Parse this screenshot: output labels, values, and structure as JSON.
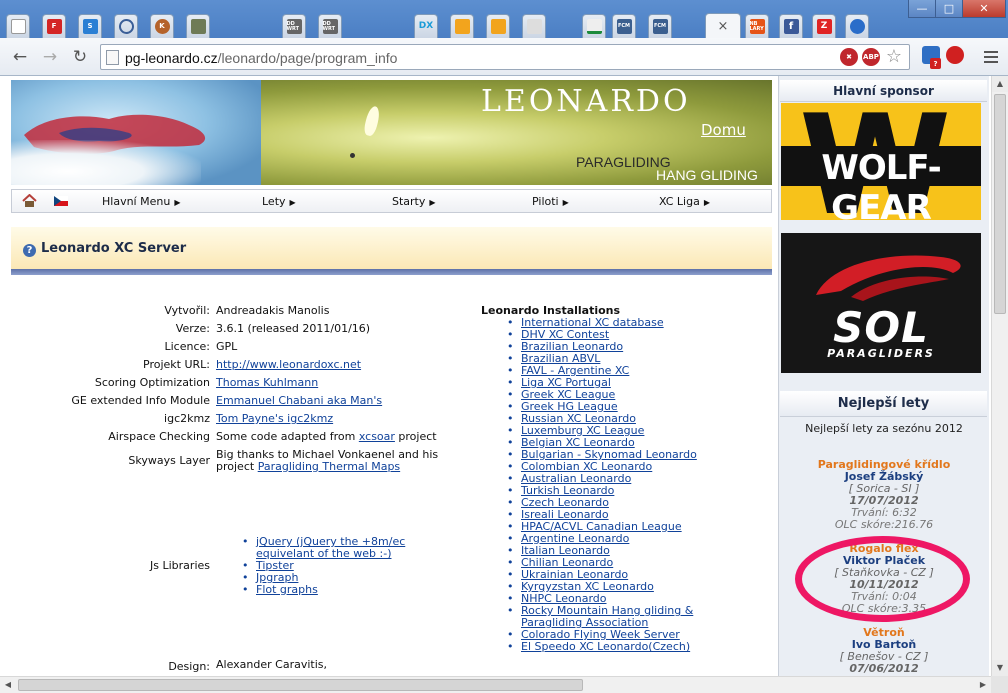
{
  "browser": {
    "tabs": [
      "",
      "F",
      "S",
      "",
      "K",
      "",
      "DD WRT",
      "DD WRT",
      "DX",
      "",
      "",
      "",
      "",
      "FCM",
      "FCM",
      "",
      "NB LARY",
      "f",
      "Z",
      ""
    ],
    "window_minimize": "—",
    "window_maximize": "□",
    "window_close": "✕",
    "tab_close": "×",
    "url_host": "pg-leonardo.cz",
    "url_path": "/leonardo/page/program_info",
    "ext_abp": "ABP",
    "ext_alert": "?"
  },
  "colors": {
    "accent": "#10429a",
    "orange": "#e2771c",
    "highlight_ring": "#ee1764",
    "wolf_yellow": "#f7c21a"
  },
  "banner": {
    "title": "LEONARDO",
    "home_link": "Domu",
    "subtitle_1": "PARAGLIDING",
    "subtitle_2": "HANG GLIDING"
  },
  "nav": {
    "home_icon": "house-icon",
    "flag_icon": "czech-flag-icon",
    "items": [
      {
        "label": "Hlavní Menu",
        "arrow": "▶"
      },
      {
        "label": "Lety",
        "arrow": "▶"
      },
      {
        "label": "Starty",
        "arrow": "▶"
      },
      {
        "label": "Piloti",
        "arrow": "▶"
      },
      {
        "label": "XC Liga",
        "arrow": "▶"
      }
    ]
  },
  "section": {
    "icon": "?",
    "title": "Leonardo XC Server"
  },
  "info": {
    "rows": [
      {
        "label": "Vytvořil:",
        "value": "Andreadakis Manolis"
      },
      {
        "label": "Verze:",
        "value": "3.6.1 (released 2011/01/16)"
      },
      {
        "label": "Licence:",
        "value": "GPL"
      },
      {
        "label": "Projekt URL:",
        "value": "http://www.leonardoxc.net"
      },
      {
        "label": "Scoring Optimization",
        "value": "Thomas Kuhlmann"
      },
      {
        "label": "GE extended Info Module",
        "value": "Emmanuel Chabani aka Man's"
      },
      {
        "label": "igc2kmz",
        "value": "Tom Payne's igc2kmz"
      },
      {
        "label": "Airspace Checking",
        "value_prefix": "Some code adapted from ",
        "value_link": "xcsoar",
        "value_suffix": " project"
      },
      {
        "label": "Skyways Layer",
        "value_line1": "Big thanks to Michael Vonkaenel and his",
        "value_line2_prefix": "project ",
        "value_line2_link": "Paragliding Thermal Maps"
      }
    ],
    "js_label": "Js Libraries",
    "js_libraries": [
      "jQuery (jQuery the +8m/ec",
      "equivelant of the web :-)",
      "Tipster",
      "Jpgraph",
      "Flot graphs"
    ],
    "design_label": "Design:",
    "design_value": "Alexander Caravitis,"
  },
  "installations": {
    "title": "Leonardo Installations",
    "items": [
      "International XC database",
      "DHV XC Contest",
      "Brazilian Leonardo",
      "Brazilian ABVL",
      "FAVL - Argentine XC",
      "Liga XC Portugal",
      "Greek XC League",
      "Greek HG League",
      "Russian XC Leonardo",
      "Luxemburg XC League",
      "Belgian XC Leonardo",
      "Bulgarian - Skynomad Leonardo",
      "Colombian XC Leonardo",
      "Australian Leonardo",
      "Turkish Leonardo",
      "Czech Leonardo",
      "Isreali Leonardo",
      "HPAC/ACVL Canadian League",
      "Argentine Leonardo",
      "Italian Leonardo",
      "Chilian Leonardo",
      "Ukrainian Leonardo",
      "Kyrgyzstan XC Leonardo",
      "NHPC Leonardo",
      "Rocky Mountain Hang gliding &",
      "Paragliding Association",
      "Colorado Flying Week Server",
      "El Speedo XC Leonardo(Czech)"
    ]
  },
  "sidebar": {
    "sponsor_title": "Hlavní sponsor",
    "sponsor1_word": "WOLF-GEAR",
    "sponsor1_letter": "W",
    "sponsor2_word": "SOL",
    "sponsor2_sub": "PARAGLIDERS",
    "best_title": "Nejlepší lety",
    "best_subtitle": "Nejlepší lety za sezónu 2012",
    "flights": [
      {
        "category": "Paraglidingové křídlo",
        "pilot": "Josef Žábský",
        "location": "[ Sorica - SI ]",
        "date": "17/07/2012",
        "duration": "Trvání: 6:32",
        "score": "OLC skóre:216.76"
      },
      {
        "category": "Rogalo flex",
        "pilot": "Viktor Plaček",
        "location": "[ Staňkovka - CZ ]",
        "date": "10/11/2012",
        "duration": "Trvání: 0:04",
        "score": "OLC skóre:3.35"
      },
      {
        "category": "Větroň",
        "pilot": "Ivo Bartoň",
        "location": "[ Benešov - CZ ]",
        "date": "07/06/2012"
      }
    ]
  }
}
